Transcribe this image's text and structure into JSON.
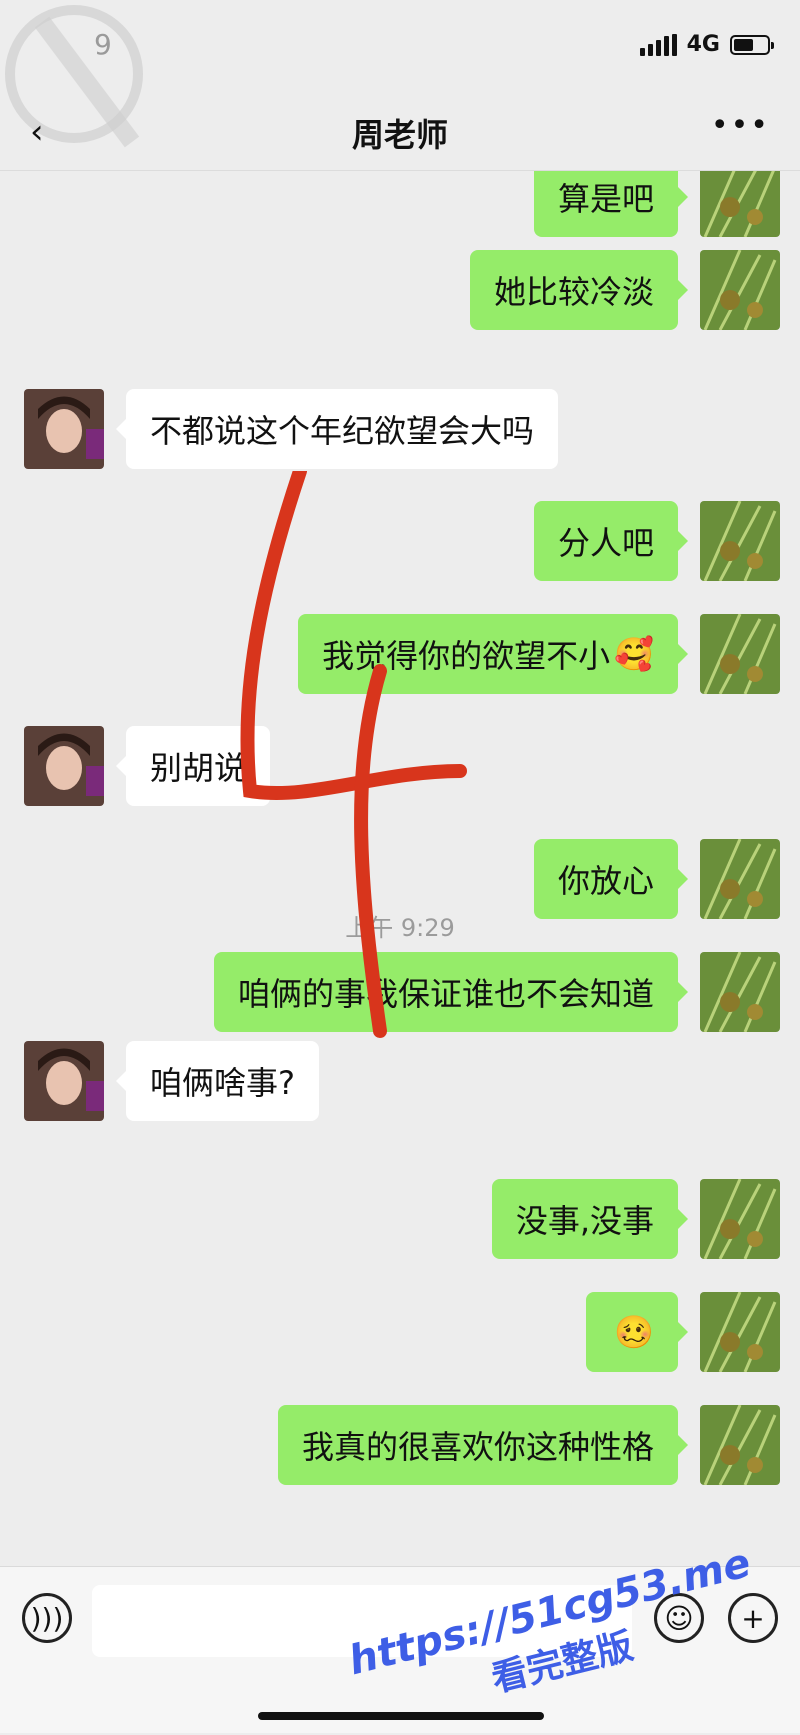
{
  "status": {
    "network": "4G",
    "battery_level": 0.6
  },
  "header": {
    "title": "周老师"
  },
  "messages": [
    {
      "side": "out",
      "text": "算是吧"
    },
    {
      "side": "out",
      "text": "她比较冷淡"
    },
    {
      "side": "in",
      "text": "不都说这个年纪欲望会大吗"
    },
    {
      "side": "out",
      "text": "分人吧"
    },
    {
      "side": "out",
      "text": "我觉得你的欲望不小",
      "emoji": "🥰"
    },
    {
      "side": "in",
      "text": "别胡说"
    },
    {
      "side": "out",
      "text": "你放心"
    },
    {
      "side": "out",
      "text": "咱俩的事我保证谁也不会知道"
    },
    {
      "side": "in",
      "text": "咱俩啥事?"
    },
    {
      "side": "out",
      "text": "没事,没事"
    },
    {
      "side": "out",
      "text": "",
      "emoji": "🥴"
    },
    {
      "side": "out",
      "text": "我真的很喜欢你这种性格"
    }
  ],
  "timestamp": "上午 9:29",
  "watermark": {
    "line1": "https://51cg53.me",
    "line2": "看完整版"
  },
  "icons": [
    "back-icon",
    "more-icon",
    "voice-icon",
    "emoji-icon",
    "plus-icon"
  ]
}
